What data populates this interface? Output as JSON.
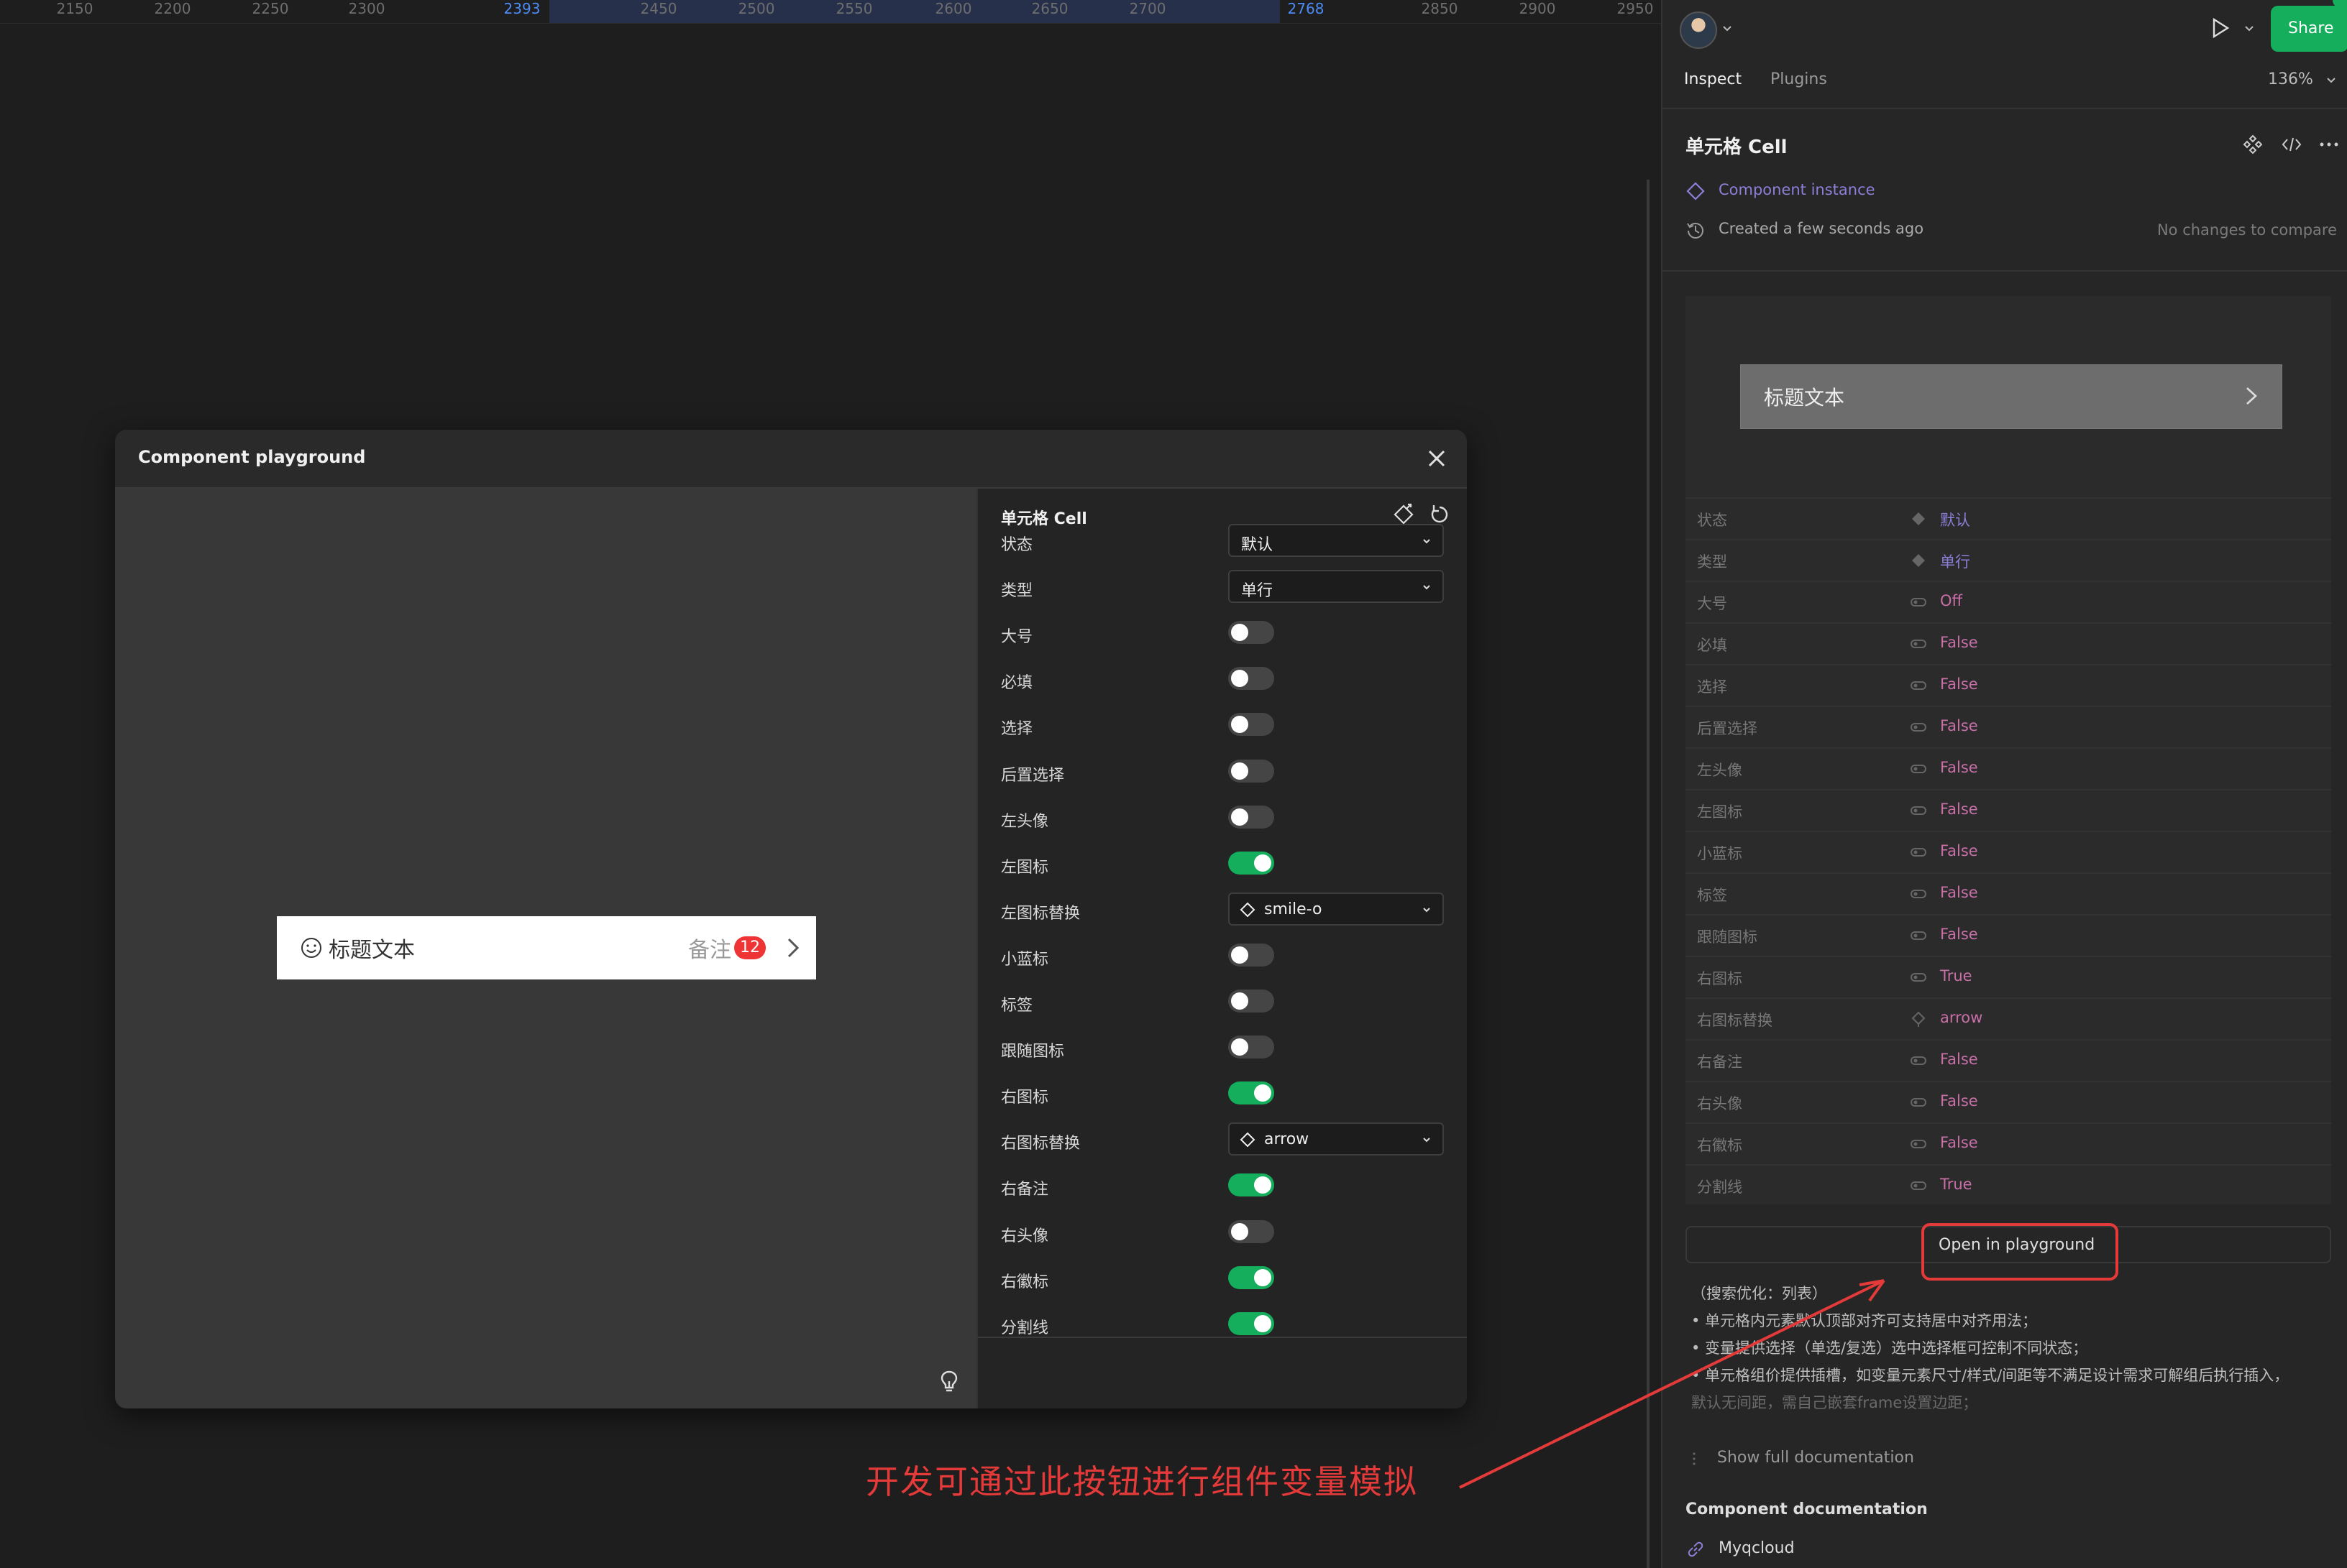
{
  "ruler": {
    "ticks": [
      "2150",
      "2200",
      "2250",
      "2300",
      "2393",
      "2450",
      "2500",
      "2550",
      "2600",
      "2650",
      "2700",
      "2768",
      "2850",
      "2900",
      "2950"
    ],
    "highlighted": [
      "2393",
      "2768"
    ]
  },
  "playground": {
    "title": "Component playground",
    "preview_cell": {
      "left_icon": "smile-o",
      "title": "标题文本",
      "note": "备注",
      "badge": "12",
      "right_icon": "arrow"
    },
    "props_title": "单元格 Cell",
    "props": [
      {
        "label": "状态",
        "kind": "select",
        "value": "默认"
      },
      {
        "label": "类型",
        "kind": "select",
        "value": "单行"
      },
      {
        "label": "大号",
        "kind": "toggle",
        "on": false
      },
      {
        "label": "必填",
        "kind": "toggle",
        "on": false
      },
      {
        "label": "选择",
        "kind": "toggle",
        "on": false
      },
      {
        "label": "后置选择",
        "kind": "toggle",
        "on": false
      },
      {
        "label": "左头像",
        "kind": "toggle",
        "on": false
      },
      {
        "label": "左图标",
        "kind": "toggle",
        "on": true
      },
      {
        "label": "左图标替换",
        "kind": "instance",
        "value": "smile-o"
      },
      {
        "label": "小蓝标",
        "kind": "toggle",
        "on": false
      },
      {
        "label": "标签",
        "kind": "toggle",
        "on": false
      },
      {
        "label": "跟随图标",
        "kind": "toggle",
        "on": false
      },
      {
        "label": "右图标",
        "kind": "toggle",
        "on": true
      },
      {
        "label": "右图标替换",
        "kind": "instance",
        "value": "arrow"
      },
      {
        "label": "右备注",
        "kind": "toggle",
        "on": true
      },
      {
        "label": "右头像",
        "kind": "toggle",
        "on": false
      },
      {
        "label": "右徽标",
        "kind": "toggle",
        "on": true
      },
      {
        "label": "分割线",
        "kind": "toggle",
        "on": true
      }
    ]
  },
  "panel": {
    "share_label": "Share",
    "tabs": [
      {
        "label": "Inspect",
        "active": true
      },
      {
        "label": "Plugins",
        "active": false
      }
    ],
    "zoom": "136%",
    "component_name": "单元格 Cell",
    "instance_label": "Component instance",
    "created": "Created a few seconds ago",
    "compare": "No changes to compare",
    "preview_title": "标题文本",
    "properties": [
      {
        "key": "状态",
        "icon": "variant",
        "value": "默认",
        "color": "purple"
      },
      {
        "key": "类型",
        "icon": "variant",
        "value": "单行",
        "color": "purple"
      },
      {
        "key": "大号",
        "icon": "boolean",
        "value": "Off",
        "color": "pink"
      },
      {
        "key": "必填",
        "icon": "boolean",
        "value": "False",
        "color": "pink"
      },
      {
        "key": "选择",
        "icon": "boolean",
        "value": "False",
        "color": "pink"
      },
      {
        "key": "后置选择",
        "icon": "boolean",
        "value": "False",
        "color": "pink"
      },
      {
        "key": "左头像",
        "icon": "boolean",
        "value": "False",
        "color": "pink"
      },
      {
        "key": "左图标",
        "icon": "boolean",
        "value": "False",
        "color": "pink"
      },
      {
        "key": "小蓝标",
        "icon": "boolean",
        "value": "False",
        "color": "pink"
      },
      {
        "key": "标签",
        "icon": "boolean",
        "value": "False",
        "color": "pink"
      },
      {
        "key": "跟随图标",
        "icon": "boolean",
        "value": "False",
        "color": "pink"
      },
      {
        "key": "右图标",
        "icon": "boolean",
        "value": "True",
        "color": "pink"
      },
      {
        "key": "右图标替换",
        "icon": "instance-swap",
        "value": "arrow",
        "color": "pink"
      },
      {
        "key": "右备注",
        "icon": "boolean",
        "value": "False",
        "color": "pink"
      },
      {
        "key": "右头像",
        "icon": "boolean",
        "value": "False",
        "color": "pink"
      },
      {
        "key": "右徽标",
        "icon": "boolean",
        "value": "False",
        "color": "pink"
      },
      {
        "key": "分割线",
        "icon": "boolean",
        "value": "True",
        "color": "pink"
      }
    ],
    "open_playground": "Open in playground",
    "doc_lines": [
      "（搜索优化：列表）",
      "• 单元格内元素默认顶部对齐可支持居中对齐用法；",
      "• 变量提供选择（单选/复选）选中选择框可控制不同状态；",
      "• 单元格组价提供插槽，如变量元素尺寸/样式/间距等不满足设计需求可解组后执行插入，",
      "  默认无间距，需自己嵌套frame设置边距；"
    ],
    "show_full_doc": "Show full documentation",
    "component_doc_title": "Component documentation",
    "doc_link": "Myqcloud"
  },
  "annotation": {
    "text": "开发可通过此按钮进行组件变量模拟",
    "color": "#e53a3a"
  },
  "colors": {
    "accent_green": "#14ae5c",
    "badge_red": "#ee3434",
    "annotation_red": "#e53a3a",
    "variant_purple": "#8b7fd8",
    "boolean_pink": "#c96fa8"
  }
}
